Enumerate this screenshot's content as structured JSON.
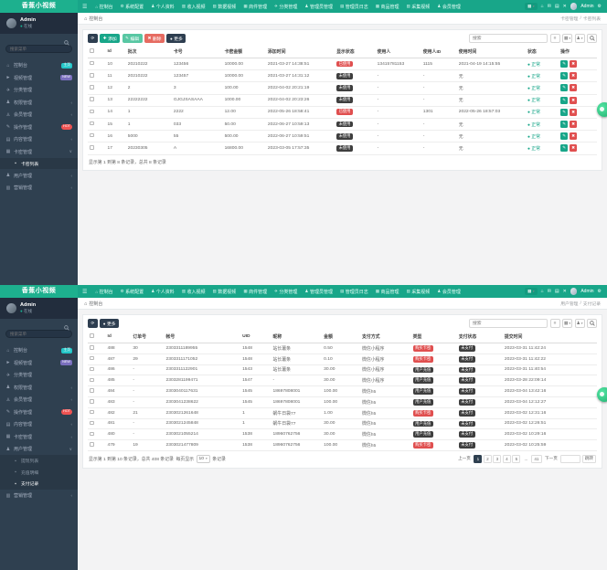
{
  "brand": "香蕉小视频",
  "navbar": {
    "items": [
      "控制台",
      "系统配置",
      "个人资料",
      "收入视频",
      "数据视频",
      "商件管理",
      "分类管理",
      "管理员管理",
      "管理员日志",
      "商品管理",
      "采集视频",
      "会员管理"
    ],
    "user_name": "Admin"
  },
  "sidebar": {
    "user_name": "Admin",
    "user_status": "在线",
    "search_placeholder": "搜索菜单",
    "items": [
      {
        "label": "控制台",
        "icon": "dashboard-icon",
        "badge": "主页",
        "badge_color": "#23c6c8"
      },
      {
        "label": "视频管理",
        "icon": "video-icon",
        "badge": "NEW",
        "badge_color": "#7a6fbe"
      },
      {
        "label": "分类管理",
        "icon": "send-icon"
      },
      {
        "label": "权限管理",
        "icon": "users-icon",
        "arrow": true
      },
      {
        "label": "会员管理",
        "icon": "member-icon",
        "arrow": true
      },
      {
        "label": "操作管理",
        "icon": "edit-icon",
        "badge": "HOT",
        "badge_color": "#ef5352",
        "pill": true
      },
      {
        "label": "内容管理",
        "icon": "content-icon",
        "arrow": true
      },
      {
        "label": "卡密管理",
        "icon": "card-icon",
        "arrow": true,
        "children": [
          "卡密列表"
        ]
      },
      {
        "label": "用户管理",
        "icon": "user-icon",
        "arrow": true,
        "children": [
          "提现列表",
          "充值明细",
          "支付记录"
        ]
      },
      {
        "label": "营销管理",
        "icon": "chart-icon",
        "arrow": true
      }
    ]
  },
  "colors": {
    "accent": "#18a689",
    "sidebar": "#2f4050",
    "danger": "#e04f4f",
    "dark_badge": "#3e3e3e"
  },
  "screens": [
    {
      "breadcrumb": "控制台",
      "location": [
        "卡密管理",
        "卡密列表"
      ],
      "open_menu": "卡密管理",
      "active_item": "卡密列表",
      "search_placeholder": "搜索",
      "toolbar": [
        {
          "icon": "refresh-icon",
          "label": "",
          "style": "dark"
        },
        {
          "icon": "plus-icon",
          "label": "添加",
          "style": "green"
        },
        {
          "icon": "edit-icon",
          "label": "编辑",
          "style": "lgreen"
        },
        {
          "icon": "trash-icon",
          "label": "删除",
          "style": "red"
        },
        {
          "icon": "dot-icon",
          "label": "更多",
          "style": "dark"
        }
      ],
      "table": {
        "columns": [
          "Id",
          "批次",
          "卡号",
          "卡密金额",
          "添加时间",
          "显示状态",
          "使用人",
          "使用人ID",
          "使用时间",
          "状态",
          "操作"
        ],
        "rows": [
          [
            "10",
            "20210222",
            "123456",
            "10000.00",
            "2021-03-27 14:38:51",
            {
              "badge": "已使用",
              "type": "red"
            },
            "13415781153",
            "1115",
            "2021-04-19 14:15:55",
            {
              "dot": "正常"
            },
            {
              "actions": true
            }
          ],
          [
            "11",
            "20210222",
            "123457",
            "10000.00",
            "2021-03-27 14:31:12",
            {
              "badge": "未使用",
              "type": "dark"
            },
            "-",
            "-",
            "无",
            {
              "dot": "正常"
            },
            {
              "actions": true
            }
          ],
          [
            "12",
            "2",
            "3",
            "100.00",
            "2022-04-02 20:21:19",
            {
              "badge": "未使用",
              "type": "dark"
            },
            "-",
            "-",
            "无",
            {
              "dot": "正常"
            },
            {
              "actions": true
            }
          ],
          [
            "13",
            "22222222",
            "GJGJSASAAA",
            "1000.00",
            "2022-04-02 20:23:26",
            {
              "badge": "未使用",
              "type": "dark"
            },
            "-",
            "-",
            "无",
            {
              "dot": "正常"
            },
            {
              "actions": true
            }
          ],
          [
            "14",
            "1",
            "2222",
            "12.00",
            "2022-05-26 18:58:41",
            {
              "badge": "已使用",
              "type": "red"
            },
            "-",
            "1301",
            "2022-05-26 18:57:03",
            {
              "dot": "正常"
            },
            {
              "actions": true
            }
          ],
          [
            "15",
            "1",
            "033",
            "50.00",
            "2022-06-27 10:59:13",
            {
              "badge": "未使用",
              "type": "dark"
            },
            "-",
            "-",
            "无",
            {
              "dot": "正常"
            },
            {
              "actions": true
            }
          ],
          [
            "16",
            "5000",
            "55",
            "500.00",
            "2022-06-27 10:59:51",
            {
              "badge": "未使用",
              "type": "dark"
            },
            "-",
            "-",
            "无",
            {
              "dot": "正常"
            },
            {
              "actions": true
            }
          ],
          [
            "17",
            "20230305",
            "A",
            "16800.00",
            "2023-03-05 17:57:35",
            {
              "badge": "未使用",
              "type": "dark"
            },
            "-",
            "-",
            "无",
            {
              "dot": "正常"
            },
            {
              "actions": true
            }
          ]
        ]
      },
      "footer_info": "显示第 1 到第 8 条记录，总共 8 条记录"
    },
    {
      "breadcrumb": "控制台",
      "location": [
        "用户管理",
        "支付记录"
      ],
      "open_menu": "用户管理",
      "active_item": "支付记录",
      "search_placeholder": "搜索",
      "toolbar": [
        {
          "icon": "refresh-icon",
          "label": "",
          "style": "dark"
        },
        {
          "icon": "dot-icon",
          "label": "更多",
          "style": "dark"
        }
      ],
      "table": {
        "columns": [
          "Id",
          "订单号",
          "帐号",
          "UID",
          "昵称",
          "金额",
          "支付方式",
          "类型",
          "支付状态",
          "提交时间"
        ],
        "rows": [
          [
            "488",
            "30",
            "2303311189955",
            "1548",
            "站长薯条",
            "0.50",
            "微信小程序",
            {
              "badge": "购买卡密",
              "type": "red"
            },
            {
              "badge": "未支付",
              "type": "dark"
            },
            "2023-03-31 11:42:24"
          ],
          [
            "487",
            "29",
            "2303311171052",
            "1548",
            "站长薯条",
            "0.10",
            "微信小程序",
            {
              "badge": "购买卡密",
              "type": "red"
            },
            {
              "badge": "未支付",
              "type": "dark"
            },
            "2023-03-31 11:42:22"
          ],
          [
            "486",
            "-",
            "2303311122901",
            "1543",
            "站长薯条",
            "30.00",
            "微信小程序",
            {
              "badge": "用户充值",
              "type": "dark"
            },
            {
              "badge": "未支付",
              "type": "dark"
            },
            "2023-03-31 11:40:54"
          ],
          [
            "485",
            "-",
            "2303281199471",
            "1547",
            "-",
            "30.00",
            "微信小程序",
            {
              "badge": "用户充值",
              "type": "dark"
            },
            {
              "badge": "未支付",
              "type": "dark"
            },
            "2023-03-28 22:09:14"
          ],
          [
            "484",
            "-",
            "2303040117631",
            "1545",
            "18697808001",
            "100.00",
            "微信h5",
            {
              "badge": "用户充值",
              "type": "dark"
            },
            {
              "badge": "未支付",
              "type": "dark"
            },
            "2023-03-04 13:42:16"
          ],
          [
            "483",
            "-",
            "2303041238622",
            "1545",
            "18697808001",
            "100.00",
            "微信h5",
            {
              "badge": "用户充值",
              "type": "dark"
            },
            {
              "badge": "未支付",
              "type": "dark"
            },
            "2023-03-04 12:12:27"
          ],
          [
            "482",
            "21",
            "2303021261648",
            "1",
            "蜗牛日袋77",
            "1.00",
            "微信h5",
            {
              "badge": "购买卡密",
              "type": "red"
            },
            {
              "badge": "未支付",
              "type": "dark"
            },
            "2023-03-02 12:31:16"
          ],
          [
            "481",
            "-",
            "2303021245848",
            "1",
            "蜗牛日袋77",
            "30.00",
            "微信h5",
            {
              "badge": "用户充值",
              "type": "dark"
            },
            {
              "badge": "未支付",
              "type": "dark"
            },
            "2023-03-02 12:26:51"
          ],
          [
            "480",
            "-",
            "2303021055214",
            "1538",
            "18960762756",
            "30.00",
            "微信h5",
            {
              "badge": "用户充值",
              "type": "dark"
            },
            {
              "badge": "未支付",
              "type": "dark"
            },
            "2023-03-02 10:29:16"
          ],
          [
            "479",
            "19",
            "2303021477809",
            "1538",
            "18960762756",
            "100.00",
            "微信h5",
            {
              "badge": "购买卡密",
              "type": "red"
            },
            {
              "badge": "未支付",
              "type": "dark"
            },
            "2023-03-02 10:25:59"
          ]
        ]
      },
      "footer_info": "显示第 1 到第 10 条记录，总共 408 条记录",
      "per_page_prefix": "每页显示",
      "per_page": "10",
      "per_page_suffix": "条记录",
      "pagination": {
        "prev": "上一页",
        "pages": [
          "1",
          "2",
          "3",
          "4",
          "5",
          "...",
          "41"
        ],
        "active": "1",
        "next": "下一页",
        "jump_label": "跳转"
      }
    }
  ]
}
